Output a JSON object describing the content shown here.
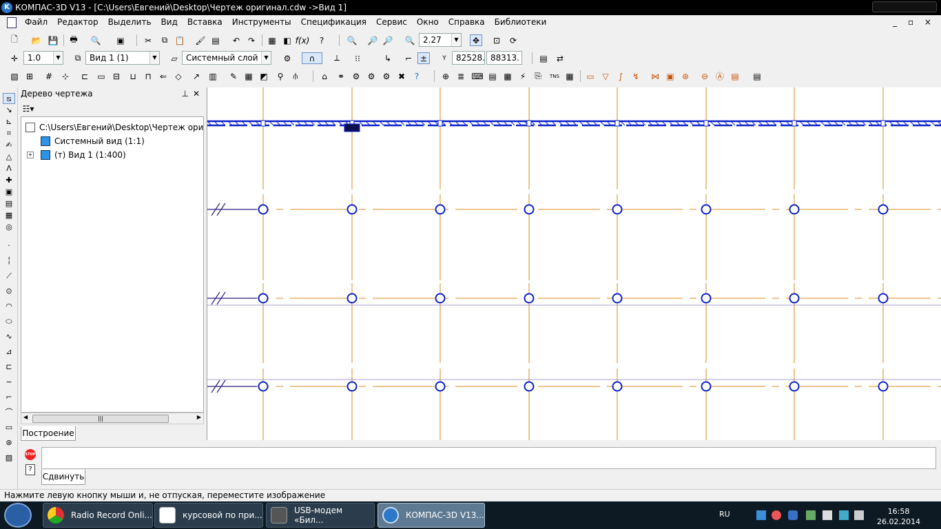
{
  "app": {
    "title": "КОМПАС-3D V13 - [C:\\Users\\Евгений\\Desktop\\Чертеж оригинал.cdw ->Вид 1]",
    "logo_letter": "K"
  },
  "menu": {
    "items": [
      "Файл",
      "Редактор",
      "Выделить",
      "Вид",
      "Вставка",
      "Инструменты",
      "Спецификация",
      "Сервис",
      "Окно",
      "Справка",
      "Библиотеки"
    ],
    "window_controls": "_ ▫ ×"
  },
  "toolbar1": {
    "zoom_value": "2.27"
  },
  "toolbar2": {
    "step_value": "1.0",
    "view_value": "Вид 1 (1)",
    "layer_value": "Системный слой (",
    "coord_x": "82528.",
    "coord_y": "88313."
  },
  "tree_panel": {
    "title": "Дерево чертежа",
    "nodes": [
      {
        "label": "C:\\Users\\Евгений\\Desktop\\Чертеж оригинал"
      },
      {
        "label": "Системный вид (1:1)"
      },
      {
        "label": "(т) Вид 1 (1:400)"
      }
    ],
    "tab_label": "Построение"
  },
  "command_panel": {
    "tab_label": "Сдвинуть",
    "stop_label": "STOP"
  },
  "status": {
    "hint": "Нажмите левую кнопку мыши и, не отпуская, переместите изображение"
  },
  "taskbar": {
    "buttons": [
      {
        "label": "Radio Record Onli..."
      },
      {
        "label": "курсовой по при..."
      },
      {
        "label": "USB-модем «Бил..."
      },
      {
        "label": "КОМПАС-3D V13..."
      }
    ],
    "lang": "RU",
    "time": "16:58",
    "date": "26.02.2014"
  },
  "colors": {
    "grid_line": "#d98a1c",
    "marker": "#0a1fc8",
    "wall": "#0a1fc8",
    "canvas_bg": "#ffffff"
  }
}
